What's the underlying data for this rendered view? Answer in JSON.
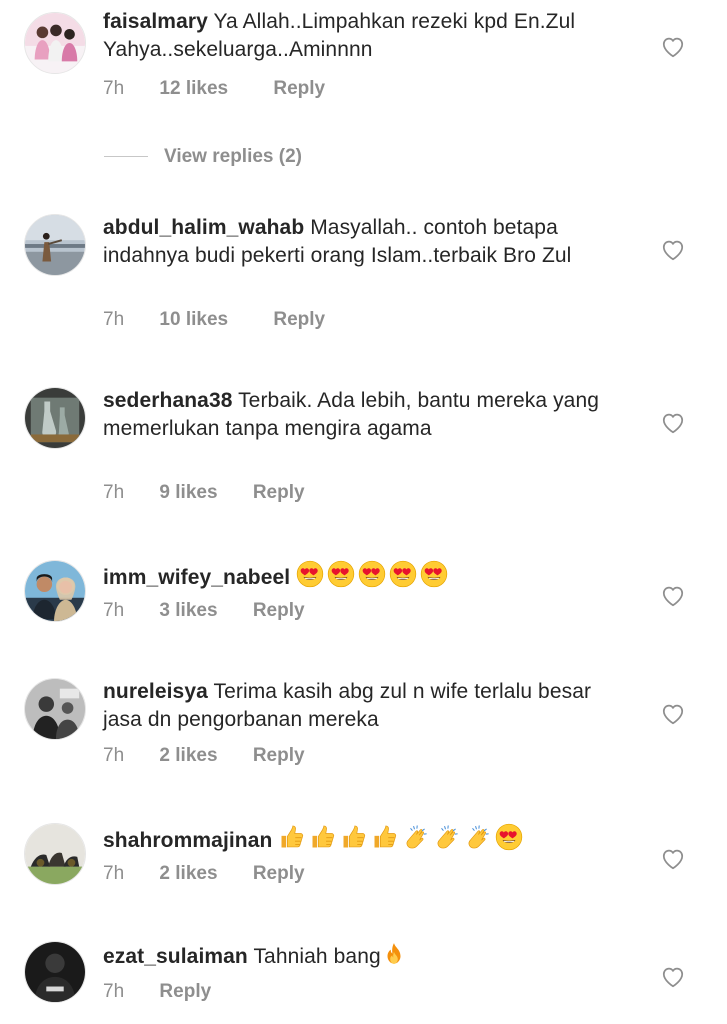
{
  "comments": [
    {
      "username": "faisalmary",
      "text": "Ya Allah..Limpahkan rezeki kpd En.Zul Yahya..sekeluarga..Aminnnn",
      "time": "7h",
      "likes": "12 likes",
      "reply": "Reply"
    },
    {
      "username": "abdul_halim_wahab",
      "text": "Masyallah.. contoh betapa indahnya budi pekerti orang Islam..terbaik Bro Zul",
      "time": "7h",
      "likes": "10 likes",
      "reply": "Reply"
    },
    {
      "username": "sederhana38",
      "text": "Terbaik. Ada lebih, bantu mereka yang memerlukan tanpa mengira agama",
      "time": "7h",
      "likes": "9 likes",
      "reply": "Reply"
    },
    {
      "username": "imm_wifey_nabeel",
      "text": "",
      "emojis": [
        "heart-eyes-emoji",
        "heart-eyes-emoji",
        "heart-eyes-emoji",
        "heart-eyes-emoji",
        "heart-eyes-emoji"
      ],
      "time": "7h",
      "likes": "3 likes",
      "reply": "Reply"
    },
    {
      "username": "nureleisya",
      "text": "Terima kasih abg zul n wife terlalu besar jasa dn pengorbanan mereka",
      "time": "7h",
      "likes": "2 likes",
      "reply": "Reply"
    },
    {
      "username": "shahrommajinan",
      "text": "",
      "emojis": [
        "thumbs-up-emoji",
        "thumbs-up-emoji",
        "thumbs-up-emoji",
        "thumbs-up-emoji",
        "clapping-hands-emoji",
        "clapping-hands-emoji",
        "clapping-hands-emoji",
        "heart-eyes-emoji"
      ],
      "time": "7h",
      "likes": "2 likes",
      "reply": "Reply"
    },
    {
      "username": "ezat_sulaiman",
      "text": "Tahniah bang",
      "emojis": [
        "fire-emoji"
      ],
      "time": "7h",
      "likes": "",
      "reply": "Reply"
    }
  ],
  "view_replies": "View replies (2)",
  "colors": {
    "text": "#262626",
    "meta": "#8e8e8e",
    "divider": "#c7c7c7"
  }
}
